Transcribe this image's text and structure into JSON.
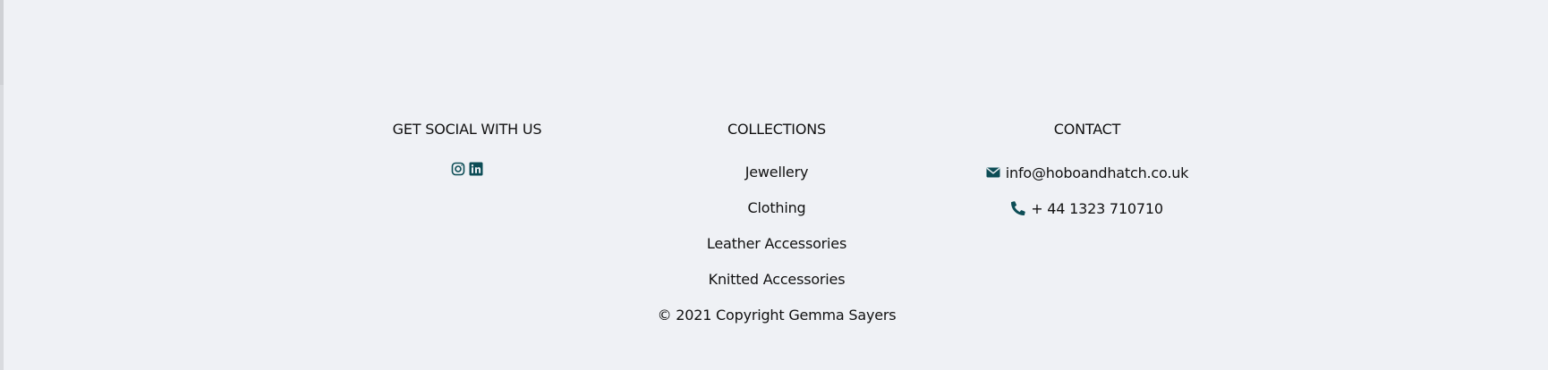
{
  "footer": {
    "social": {
      "heading": "GET SOCIAL WITH US",
      "icons": [
        "instagram-icon",
        "linkedin-icon"
      ]
    },
    "collections": {
      "heading": "COLLECTIONS",
      "items": [
        "Jewellery",
        "Clothing",
        "Leather Accessories",
        "Knitted Accessories"
      ],
      "copyright": "© 2021 Copyright Gemma Sayers"
    },
    "contact": {
      "heading": "CONTACT",
      "email": "info@hoboandhatch.co.uk",
      "phone": "+ 44 1323 710710"
    }
  },
  "colors": {
    "background": "#eff1f5",
    "icon_accent": "#0d4d56",
    "text": "#111111"
  }
}
